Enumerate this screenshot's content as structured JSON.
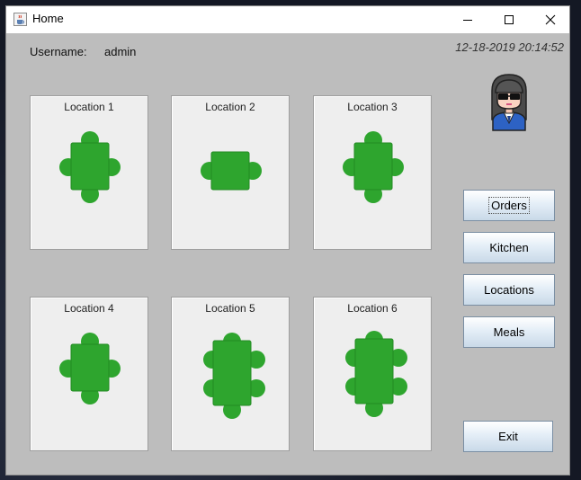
{
  "window": {
    "title": "Home",
    "icon": "java-cup-icon",
    "controls": [
      "minimize-icon",
      "maximize-icon",
      "close-icon"
    ]
  },
  "header": {
    "username_label": "Username:",
    "username_value": "admin",
    "datetime": "12-18-2019 20:14:52"
  },
  "locations": [
    {
      "label": "Location 1",
      "table": "4-seat-tall"
    },
    {
      "label": "Location 2",
      "table": "2-seat-square"
    },
    {
      "label": "Location 3",
      "table": "4-seat-tall"
    },
    {
      "label": "Location 4",
      "table": "4-seat-tall"
    },
    {
      "label": "Location 5",
      "table": "6-seat-long"
    },
    {
      "label": "Location 6",
      "table": "6-seat-long"
    }
  ],
  "menu": {
    "orders": "Orders",
    "kitchen": "Kitchen",
    "locations": "Locations",
    "meals": "Meals",
    "exit": "Exit"
  },
  "colors": {
    "table_green": "#2ea52e",
    "panel_bg": "#bdbdbd",
    "card_bg": "#eeeeee"
  },
  "avatar": "user-avatar-icon"
}
